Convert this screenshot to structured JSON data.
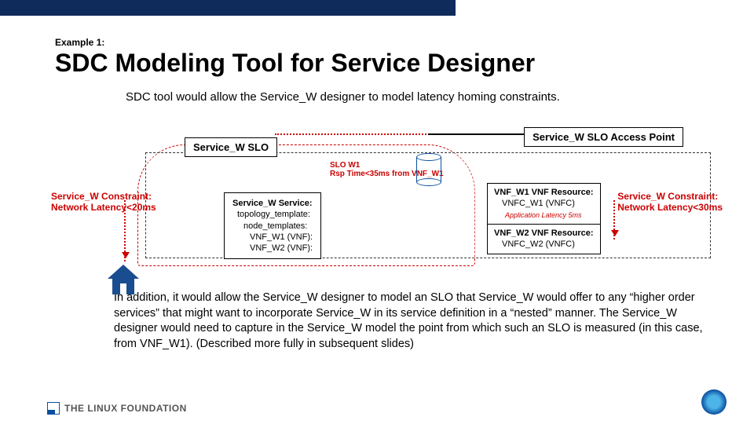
{
  "header": {
    "example": "Example 1:",
    "title": "SDC Modeling Tool for Service Designer",
    "subtitle": "SDC tool would allow the Service_W designer to model latency homing constraints."
  },
  "diagram": {
    "slo_label": "Service_W SLO",
    "access_label": "Service_W SLO Access Point",
    "constraint_left": "Service_W Constraint:\nNetwork Latency<20ms",
    "constraint_right": "Service_W Constraint:\nNetwork Latency<30ms",
    "slo_w1": "SLO W1\nRsp Time<35ms from VNF_W1",
    "service": {
      "title": "Service_W Service:",
      "l1": "topology_template:",
      "l2": "node_templates:",
      "l3": "VNF_W1 (VNF):",
      "l4": "VNF_W2 (VNF):"
    },
    "vnf1": {
      "title": "VNF_W1 VNF Resource:",
      "sub": "VNFC_W1 (VNFC)",
      "small": "Application Latency 5ms"
    },
    "vnf2": {
      "title": "VNF_W2 VNF Resource:",
      "sub": "VNFC_W2 (VNFC)"
    }
  },
  "paragraph": "In addition, it would allow the Service_W designer to model an SLO that Service_W would offer to any “higher order services” that might want to incorporate Service_W in its service definition in a “nested” manner.  The Service_W designer would need to capture in the Service_W model the point from which such an SLO is measured (in this case, from VNF_W1).  (Described more fully in subsequent slides)",
  "footer": {
    "logo": "THE LINUX FOUNDATION"
  }
}
